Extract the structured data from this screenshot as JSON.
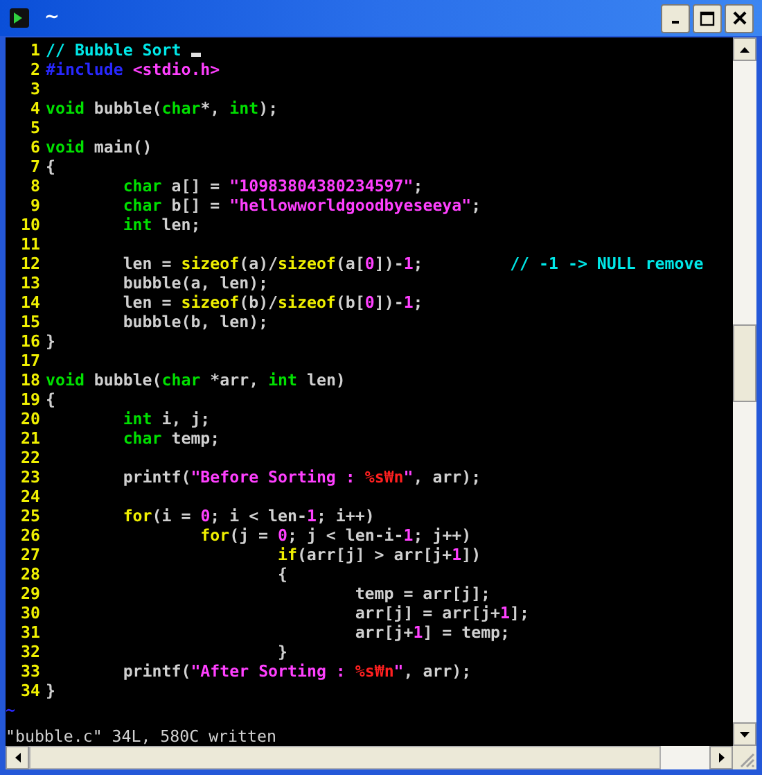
{
  "window": {
    "title": "~"
  },
  "lines": [
    {
      "number": "1",
      "tokens": [
        {
          "kind": "comment",
          "text": "// Bubble Sort"
        },
        {
          "kind": "space"
        },
        {
          "kind": "cursor"
        }
      ]
    },
    {
      "number": "2",
      "tokens": [
        {
          "kind": "preproc",
          "text": "#include"
        },
        {
          "kind": "space"
        },
        {
          "kind": "string",
          "text": "<stdio.h>"
        }
      ]
    },
    {
      "number": "3"
    },
    {
      "number": "4",
      "tokens": [
        {
          "kind": "type",
          "text": "void"
        },
        {
          "kind": "plain",
          "text": " bubble("
        },
        {
          "kind": "type",
          "text": "char"
        },
        {
          "kind": "plain",
          "text": "*, "
        },
        {
          "kind": "type",
          "text": "int"
        },
        {
          "kind": "plain",
          "text": ");"
        }
      ]
    },
    {
      "number": "5"
    },
    {
      "number": "6",
      "tokens": [
        {
          "kind": "type",
          "text": "void"
        },
        {
          "kind": "plain",
          "text": " main()"
        }
      ]
    },
    {
      "number": "7",
      "tokens": [
        {
          "kind": "plain",
          "text": "{"
        }
      ]
    },
    {
      "number": "8",
      "tokens": [
        {
          "kind": "tab"
        },
        {
          "kind": "type",
          "text": "char"
        },
        {
          "kind": "plain",
          "text": " a[] = "
        },
        {
          "kind": "string",
          "text": "\"10983804380234597\""
        },
        {
          "kind": "plain",
          "text": ";"
        }
      ]
    },
    {
      "number": "9",
      "tokens": [
        {
          "kind": "tab"
        },
        {
          "kind": "type",
          "text": "char"
        },
        {
          "kind": "plain",
          "text": " b[] = "
        },
        {
          "kind": "string",
          "text": "\"hellowworldgoodbyeseeya\""
        },
        {
          "kind": "plain",
          "text": ";"
        }
      ]
    },
    {
      "number": "10",
      "tokens": [
        {
          "kind": "tab"
        },
        {
          "kind": "type",
          "text": "int"
        },
        {
          "kind": "plain",
          "text": " len;"
        }
      ]
    },
    {
      "number": "11"
    },
    {
      "number": "12",
      "tokens": [
        {
          "kind": "tab"
        },
        {
          "kind": "plain",
          "text": "len = "
        },
        {
          "kind": "keyword",
          "text": "sizeof"
        },
        {
          "kind": "plain",
          "text": "(a)/"
        },
        {
          "kind": "keyword",
          "text": "sizeof"
        },
        {
          "kind": "plain",
          "text": "(a["
        },
        {
          "kind": "number",
          "text": "0"
        },
        {
          "kind": "plain",
          "text": "])-"
        },
        {
          "kind": "number",
          "text": "1"
        },
        {
          "kind": "plain",
          "text": ";"
        },
        {
          "kind": "tab"
        },
        {
          "kind": "space"
        },
        {
          "kind": "comment",
          "text": "// -1 -> NULL remove"
        }
      ]
    },
    {
      "number": "13",
      "tokens": [
        {
          "kind": "tab"
        },
        {
          "kind": "plain",
          "text": "bubble(a, len);"
        }
      ]
    },
    {
      "number": "14",
      "tokens": [
        {
          "kind": "tab"
        },
        {
          "kind": "plain",
          "text": "len = "
        },
        {
          "kind": "keyword",
          "text": "sizeof"
        },
        {
          "kind": "plain",
          "text": "(b)/"
        },
        {
          "kind": "keyword",
          "text": "sizeof"
        },
        {
          "kind": "plain",
          "text": "(b["
        },
        {
          "kind": "number",
          "text": "0"
        },
        {
          "kind": "plain",
          "text": "])-"
        },
        {
          "kind": "number",
          "text": "1"
        },
        {
          "kind": "plain",
          "text": ";"
        }
      ]
    },
    {
      "number": "15",
      "tokens": [
        {
          "kind": "tab"
        },
        {
          "kind": "plain",
          "text": "bubble(b, len);"
        }
      ]
    },
    {
      "number": "16",
      "tokens": [
        {
          "kind": "plain",
          "text": "}"
        }
      ]
    },
    {
      "number": "17"
    },
    {
      "number": "18",
      "tokens": [
        {
          "kind": "type",
          "text": "void"
        },
        {
          "kind": "plain",
          "text": " bubble("
        },
        {
          "kind": "type",
          "text": "char"
        },
        {
          "kind": "plain",
          "text": " *arr, "
        },
        {
          "kind": "type",
          "text": "int"
        },
        {
          "kind": "plain",
          "text": " len)"
        }
      ]
    },
    {
      "number": "19",
      "tokens": [
        {
          "kind": "plain",
          "text": "{"
        }
      ]
    },
    {
      "number": "20",
      "tokens": [
        {
          "kind": "tab"
        },
        {
          "kind": "type",
          "text": "int"
        },
        {
          "kind": "plain",
          "text": " i, j;"
        }
      ]
    },
    {
      "number": "21",
      "tokens": [
        {
          "kind": "tab"
        },
        {
          "kind": "type",
          "text": "char"
        },
        {
          "kind": "plain",
          "text": " temp;"
        }
      ]
    },
    {
      "number": "22"
    },
    {
      "number": "23",
      "tokens": [
        {
          "kind": "tab"
        },
        {
          "kind": "plain",
          "text": "printf("
        },
        {
          "kind": "string",
          "text": "\"Before Sorting : "
        },
        {
          "kind": "special",
          "text": "%s₩n"
        },
        {
          "kind": "string",
          "text": "\""
        },
        {
          "kind": "plain",
          "text": ", arr);"
        }
      ]
    },
    {
      "number": "24"
    },
    {
      "number": "25",
      "tokens": [
        {
          "kind": "tab"
        },
        {
          "kind": "keyword",
          "text": "for"
        },
        {
          "kind": "plain",
          "text": "(i = "
        },
        {
          "kind": "number",
          "text": "0"
        },
        {
          "kind": "plain",
          "text": "; i < len-"
        },
        {
          "kind": "number",
          "text": "1"
        },
        {
          "kind": "plain",
          "text": "; i++)"
        }
      ]
    },
    {
      "number": "26",
      "tokens": [
        {
          "kind": "tab"
        },
        {
          "kind": "tab"
        },
        {
          "kind": "keyword",
          "text": "for"
        },
        {
          "kind": "plain",
          "text": "(j = "
        },
        {
          "kind": "number",
          "text": "0"
        },
        {
          "kind": "plain",
          "text": "; j < len-i-"
        },
        {
          "kind": "number",
          "text": "1"
        },
        {
          "kind": "plain",
          "text": "; j++)"
        }
      ]
    },
    {
      "number": "27",
      "tokens": [
        {
          "kind": "tab"
        },
        {
          "kind": "tab"
        },
        {
          "kind": "tab"
        },
        {
          "kind": "keyword",
          "text": "if"
        },
        {
          "kind": "plain",
          "text": "(arr[j] > arr[j+"
        },
        {
          "kind": "number",
          "text": "1"
        },
        {
          "kind": "plain",
          "text": "])"
        }
      ]
    },
    {
      "number": "28",
      "tokens": [
        {
          "kind": "tab"
        },
        {
          "kind": "tab"
        },
        {
          "kind": "tab"
        },
        {
          "kind": "plain",
          "text": "{"
        }
      ]
    },
    {
      "number": "29",
      "tokens": [
        {
          "kind": "tab"
        },
        {
          "kind": "tab"
        },
        {
          "kind": "tab"
        },
        {
          "kind": "tab"
        },
        {
          "kind": "plain",
          "text": "temp = arr[j];"
        }
      ]
    },
    {
      "number": "30",
      "tokens": [
        {
          "kind": "tab"
        },
        {
          "kind": "tab"
        },
        {
          "kind": "tab"
        },
        {
          "kind": "tab"
        },
        {
          "kind": "plain",
          "text": "arr[j] = arr[j+"
        },
        {
          "kind": "number",
          "text": "1"
        },
        {
          "kind": "plain",
          "text": "];"
        }
      ]
    },
    {
      "number": "31",
      "tokens": [
        {
          "kind": "tab"
        },
        {
          "kind": "tab"
        },
        {
          "kind": "tab"
        },
        {
          "kind": "tab"
        },
        {
          "kind": "plain",
          "text": "arr[j+"
        },
        {
          "kind": "number",
          "text": "1"
        },
        {
          "kind": "plain",
          "text": "] = temp;"
        }
      ]
    },
    {
      "number": "32",
      "tokens": [
        {
          "kind": "tab"
        },
        {
          "kind": "tab"
        },
        {
          "kind": "tab"
        },
        {
          "kind": "plain",
          "text": "}"
        }
      ]
    },
    {
      "number": "33",
      "tokens": [
        {
          "kind": "tab"
        },
        {
          "kind": "plain",
          "text": "printf("
        },
        {
          "kind": "string",
          "text": "\"After Sorting : "
        },
        {
          "kind": "special",
          "text": "%s₩n"
        },
        {
          "kind": "string",
          "text": "\""
        },
        {
          "kind": "plain",
          "text": ", arr);"
        }
      ]
    },
    {
      "number": "34",
      "tokens": [
        {
          "kind": "plain",
          "text": "}"
        }
      ]
    }
  ],
  "filler_lines": [
    "~"
  ],
  "status_message": "\"bubble.c\" 34L, 580C written"
}
